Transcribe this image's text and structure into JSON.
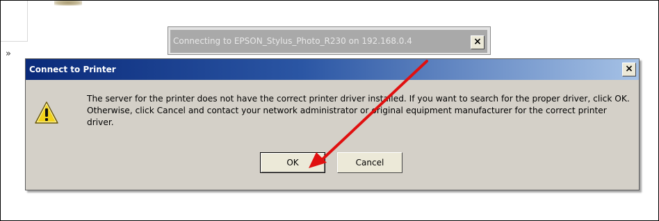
{
  "background": {
    "chevron_glyph": "»"
  },
  "back_dialog": {
    "title": "Connecting to EPSON_Stylus_Photo_R230 on 192.168.0.4",
    "close_glyph": "×"
  },
  "dialog": {
    "title": "Connect to Printer",
    "close_glyph": "×",
    "message": "The server for the printer does not have the correct printer driver installed.  If you want to search for the proper driver, click OK.  Otherwise, click Cancel and contact your network administrator or original equipment manufacturer for the correct printer driver.",
    "ok_label": "OK",
    "cancel_label": "Cancel",
    "icon": "warning-icon"
  },
  "annotation": {
    "arrow_color": "#e01010"
  },
  "colors": {
    "title_bar_start": "#0a2a7a",
    "title_bar_end": "#a6c2e6",
    "dialog_bg": "#d4d0c8",
    "warning_yellow": "#f2d21a"
  }
}
